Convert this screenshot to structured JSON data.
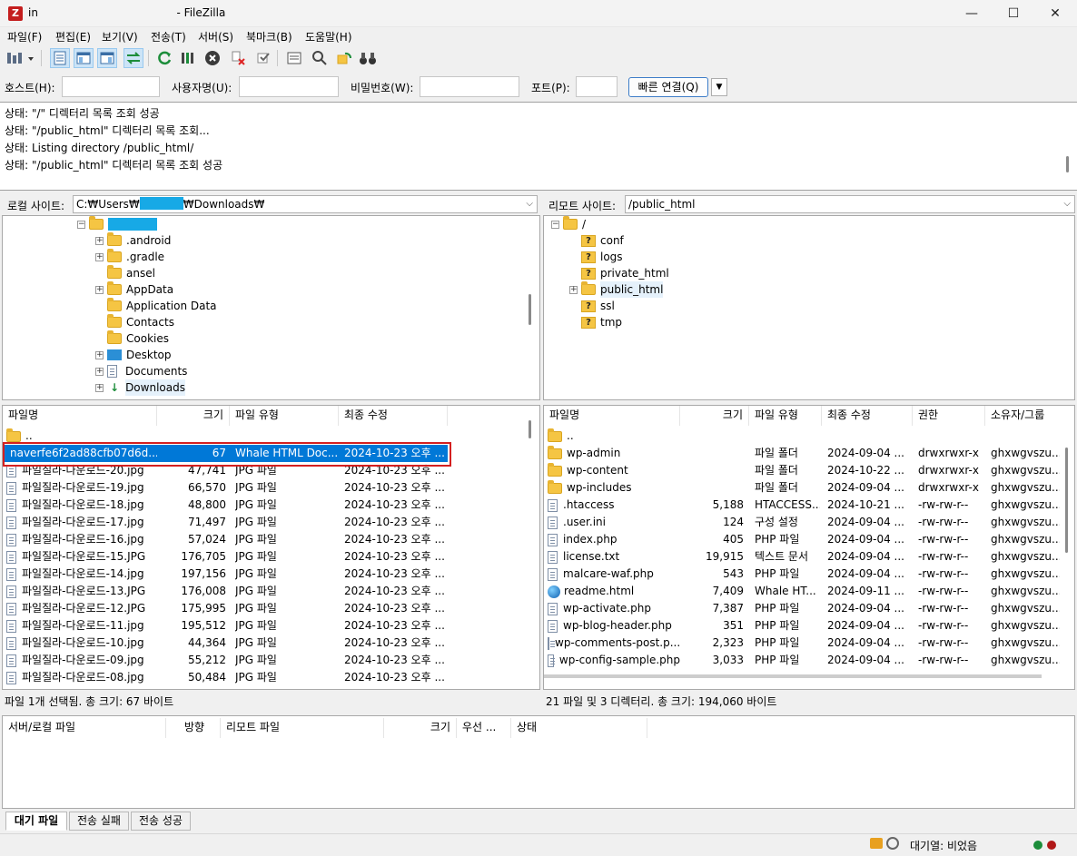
{
  "window": {
    "title": "in                                        - FileZilla",
    "icon": "filezilla-icon",
    "buttons": [
      "—",
      "☐",
      "✕"
    ]
  },
  "menu": [
    "파일(F)",
    "편집(E)",
    "보기(V)",
    "전송(T)",
    "서버(S)",
    "북마크(B)",
    "도움말(H)"
  ],
  "quickconnect": {
    "host_label": "호스트(H):",
    "user_label": "사용자명(U):",
    "pass_label": "비밀번호(W):",
    "port_label": "포트(P):",
    "button_label": "빠른 연결(Q)",
    "host_value": "",
    "user_value": "",
    "pass_value": "",
    "port_value": ""
  },
  "log": [
    "상태:  \"/\" 디렉터리 목록 조회 성공",
    "상태:  \"/public_html\" 디렉터리 목록 조회...",
    "상태:  Listing directory /public_html/",
    "상태:  \"/public_html\" 디렉터리 목록 조회 성공"
  ],
  "local": {
    "site_label": "로컬 사이트:",
    "path_prefix": "C:₩Users₩",
    "path_suffix": "₩Downloads₩",
    "tree": [
      {
        "label": ".android",
        "expander": "+"
      },
      {
        "label": ".gradle",
        "expander": "+"
      },
      {
        "label": "ansel",
        "expander": ""
      },
      {
        "label": "AppData",
        "expander": "+"
      },
      {
        "label": "Application Data",
        "expander": ""
      },
      {
        "label": "Contacts",
        "expander": ""
      },
      {
        "label": "Cookies",
        "expander": ""
      },
      {
        "label": "Desktop",
        "expander": "+"
      },
      {
        "label": "Documents",
        "expander": "+"
      },
      {
        "label": "Downloads",
        "expander": "+"
      }
    ],
    "columns": [
      "파일명",
      "크기",
      "파일 유형",
      "최종 수정"
    ],
    "files": [
      {
        "name": "..",
        "size": "",
        "type": "",
        "modified": ""
      },
      {
        "name": "naverfe6f2ad88cfb07d6d...",
        "size": "67",
        "type": "Whale HTML Doc...",
        "modified": "2024-10-23 오후 ..."
      },
      {
        "name": "파일질라-다운로드-20.jpg",
        "size": "47,741",
        "type": "JPG 파일",
        "modified": "2024-10-23 오후 ..."
      },
      {
        "name": "파일질라-다운로드-19.jpg",
        "size": "66,570",
        "type": "JPG 파일",
        "modified": "2024-10-23 오후 ..."
      },
      {
        "name": "파일질라-다운로드-18.jpg",
        "size": "48,800",
        "type": "JPG 파일",
        "modified": "2024-10-23 오후 ..."
      },
      {
        "name": "파일질라-다운로드-17.jpg",
        "size": "71,497",
        "type": "JPG 파일",
        "modified": "2024-10-23 오후 ..."
      },
      {
        "name": "파일질라-다운로드-16.jpg",
        "size": "57,024",
        "type": "JPG 파일",
        "modified": "2024-10-23 오후 ..."
      },
      {
        "name": "파일질라-다운로드-15.JPG",
        "size": "176,705",
        "type": "JPG 파일",
        "modified": "2024-10-23 오후 ..."
      },
      {
        "name": "파일질라-다운로드-14.jpg",
        "size": "197,156",
        "type": "JPG 파일",
        "modified": "2024-10-23 오후 ..."
      },
      {
        "name": "파일질라-다운로드-13.JPG",
        "size": "176,008",
        "type": "JPG 파일",
        "modified": "2024-10-23 오후 ..."
      },
      {
        "name": "파일질라-다운로드-12.JPG",
        "size": "175,995",
        "type": "JPG 파일",
        "modified": "2024-10-23 오후 ..."
      },
      {
        "name": "파일질라-다운로드-11.jpg",
        "size": "195,512",
        "type": "JPG 파일",
        "modified": "2024-10-23 오후 ..."
      },
      {
        "name": "파일질라-다운로드-10.jpg",
        "size": "44,364",
        "type": "JPG 파일",
        "modified": "2024-10-23 오후 ..."
      },
      {
        "name": "파일질라-다운로드-09.jpg",
        "size": "55,212",
        "type": "JPG 파일",
        "modified": "2024-10-23 오후 ..."
      },
      {
        "name": "파일질라-다운로드-08.jpg",
        "size": "50,484",
        "type": "JPG 파일",
        "modified": "2024-10-23 오후 ..."
      }
    ],
    "status": "파일 1개 선택됨. 총 크기: 67 바이트"
  },
  "remote": {
    "site_label": "리모트 사이트:",
    "path": "/public_html",
    "tree_root": "/",
    "tree": [
      {
        "label": "conf",
        "expander": ""
      },
      {
        "label": "logs",
        "expander": ""
      },
      {
        "label": "private_html",
        "expander": ""
      },
      {
        "label": "public_html",
        "expander": "+"
      },
      {
        "label": "ssl",
        "expander": ""
      },
      {
        "label": "tmp",
        "expander": ""
      }
    ],
    "columns": [
      "파일명",
      "크기",
      "파일 유형",
      "최종 수정",
      "권한",
      "소유자/그룹"
    ],
    "files": [
      {
        "name": "..",
        "icon": "folder",
        "size": "",
        "type": "",
        "modified": "",
        "perm": "",
        "owner": ""
      },
      {
        "name": "wp-admin",
        "icon": "folder",
        "size": "",
        "type": "파일 폴더",
        "modified": "2024-09-04 ...",
        "perm": "drwxrwxr-x",
        "owner": "ghxwgvszu..."
      },
      {
        "name": "wp-content",
        "icon": "folder",
        "size": "",
        "type": "파일 폴더",
        "modified": "2024-10-22 ...",
        "perm": "drwxrwxr-x",
        "owner": "ghxwgvszu..."
      },
      {
        "name": "wp-includes",
        "icon": "folder",
        "size": "",
        "type": "파일 폴더",
        "modified": "2024-09-04 ...",
        "perm": "drwxrwxr-x",
        "owner": "ghxwgvszu..."
      },
      {
        "name": ".htaccess",
        "icon": "doc",
        "size": "5,188",
        "type": "HTACCESS...",
        "modified": "2024-10-21 ...",
        "perm": "-rw-rw-r--",
        "owner": "ghxwgvszu..."
      },
      {
        "name": ".user.ini",
        "icon": "doc",
        "size": "124",
        "type": "구성 설정",
        "modified": "2024-09-04 ...",
        "perm": "-rw-rw-r--",
        "owner": "ghxwgvszu..."
      },
      {
        "name": "index.php",
        "icon": "doc",
        "size": "405",
        "type": "PHP 파일",
        "modified": "2024-09-04 ...",
        "perm": "-rw-rw-r--",
        "owner": "ghxwgvszu..."
      },
      {
        "name": "license.txt",
        "icon": "doc",
        "size": "19,915",
        "type": "텍스트 문서",
        "modified": "2024-09-04 ...",
        "perm": "-rw-rw-r--",
        "owner": "ghxwgvszu..."
      },
      {
        "name": "malcare-waf.php",
        "icon": "doc",
        "size": "543",
        "type": "PHP 파일",
        "modified": "2024-09-04 ...",
        "perm": "-rw-rw-r--",
        "owner": "ghxwgvszu..."
      },
      {
        "name": "readme.html",
        "icon": "web",
        "size": "7,409",
        "type": "Whale HT...",
        "modified": "2024-09-11 ...",
        "perm": "-rw-rw-r--",
        "owner": "ghxwgvszu..."
      },
      {
        "name": "wp-activate.php",
        "icon": "doc",
        "size": "7,387",
        "type": "PHP 파일",
        "modified": "2024-09-04 ...",
        "perm": "-rw-rw-r--",
        "owner": "ghxwgvszu..."
      },
      {
        "name": "wp-blog-header.php",
        "icon": "doc",
        "size": "351",
        "type": "PHP 파일",
        "modified": "2024-09-04 ...",
        "perm": "-rw-rw-r--",
        "owner": "ghxwgvszu..."
      },
      {
        "name": "wp-comments-post.p...",
        "icon": "doc",
        "size": "2,323",
        "type": "PHP 파일",
        "modified": "2024-09-04 ...",
        "perm": "-rw-rw-r--",
        "owner": "ghxwgvszu..."
      },
      {
        "name": "wp-config-sample.php",
        "icon": "doc",
        "size": "3,033",
        "type": "PHP 파일",
        "modified": "2024-09-04 ...",
        "perm": "-rw-rw-r--",
        "owner": "ghxwgvszu..."
      }
    ],
    "status": "21 파일 및 3 디렉터리. 총 크기: 194,060 바이트"
  },
  "queue": {
    "columns": [
      "서버/로컬 파일",
      "방향",
      "리모트 파일",
      "크기",
      "우선 ...",
      "상태"
    ],
    "tabs": [
      "대기 파일",
      "전송 실패",
      "전송 성공"
    ],
    "status": "대기열: 비었음"
  },
  "colors": {
    "selection": "#0078d7",
    "highlight_box": "#d42020",
    "accent": "#3d7dc8"
  }
}
